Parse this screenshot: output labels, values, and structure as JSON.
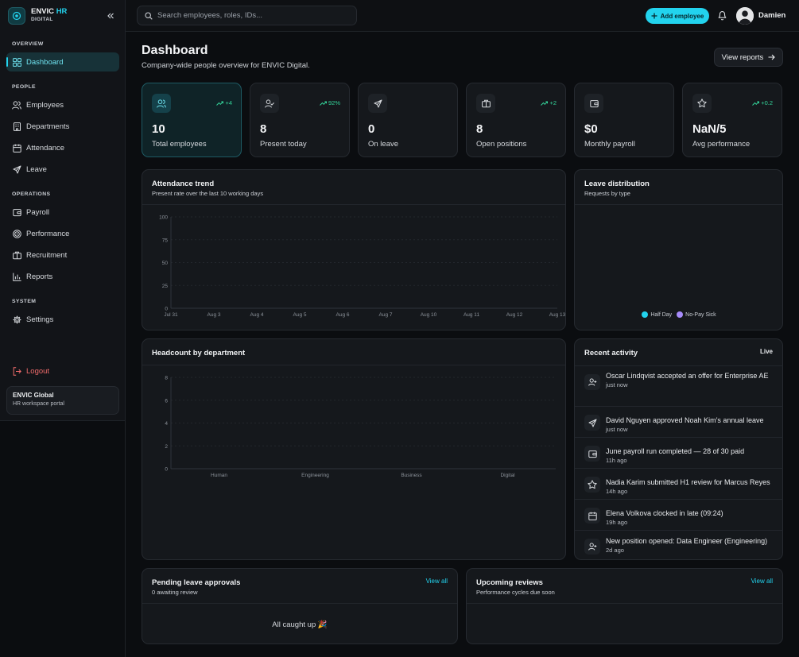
{
  "brand": {
    "name": "ENVIC",
    "name_accent": "HR",
    "sub": "DIGITAL"
  },
  "sidebar": {
    "sections": [
      {
        "label": "OVERVIEW"
      },
      {
        "label": "PEOPLE"
      },
      {
        "label": "OPERATIONS"
      },
      {
        "label": "SYSTEM"
      }
    ],
    "items": [
      {
        "label": "Dashboard",
        "icon": "grid-icon"
      },
      {
        "label": "Employees",
        "icon": "users-icon"
      },
      {
        "label": "Departments",
        "icon": "building-icon"
      },
      {
        "label": "Attendance",
        "icon": "calendar-icon"
      },
      {
        "label": "Leave",
        "icon": "plane-icon"
      },
      {
        "label": "Payroll",
        "icon": "wallet-icon"
      },
      {
        "label": "Performance",
        "icon": "target-icon"
      },
      {
        "label": "Recruitment",
        "icon": "briefcase-icon"
      },
      {
        "label": "Reports",
        "icon": "bar-chart-icon"
      },
      {
        "label": "Settings",
        "icon": "gear-icon"
      }
    ],
    "logout_label": "Logout",
    "org": {
      "name": "ENVIC Global",
      "sub": "HR workspace portal"
    }
  },
  "topbar": {
    "search_placeholder": "Search employees, roles, IDs...",
    "add_label": "Add employee",
    "user_name": "Damien"
  },
  "header": {
    "title": "Dashboard",
    "subtitle": "Company-wide people overview for ENVIC Digital.",
    "view_reports": "View reports"
  },
  "stats": [
    {
      "value": "10",
      "label": "Total employees",
      "delta": "+4",
      "icon": "users-icon"
    },
    {
      "value": "8",
      "label": "Present today",
      "delta": "92%",
      "icon": "user-check-icon"
    },
    {
      "value": "0",
      "label": "On leave",
      "delta": "",
      "icon": "plane-icon"
    },
    {
      "value": "8",
      "label": "Open positions",
      "delta": "+2",
      "icon": "briefcase-icon"
    },
    {
      "value": "$0",
      "label": "Monthly payroll",
      "delta": "",
      "icon": "wallet-icon"
    },
    {
      "value": "NaN/5",
      "label": "Avg performance",
      "delta": "+0.2",
      "icon": "star-icon"
    }
  ],
  "attendance": {
    "title": "Attendance trend",
    "subtitle": "Present rate over the last 10 working days"
  },
  "leave_dist": {
    "title": "Leave distribution",
    "subtitle": "Requests by type",
    "legend": [
      {
        "name": "Half Day",
        "color": "#22d3ee"
      },
      {
        "name": "No-Pay Sick",
        "color": "#a78bfa"
      }
    ]
  },
  "headcount": {
    "title": "Headcount by department"
  },
  "activity": {
    "title": "Recent activity",
    "live": "Live",
    "items": [
      {
        "text": "Oscar Lindqvist accepted an offer for Enterprise AE",
        "time": "just now",
        "icon": "user-plus-icon"
      },
      {
        "text": "David Nguyen approved Noah Kim’s annual leave",
        "time": "just now",
        "icon": "plane-icon"
      },
      {
        "text": "June payroll run completed — 28 of 30 paid",
        "time": "11h ago",
        "icon": "wallet-icon"
      },
      {
        "text": "Nadia Karim submitted H1 review for Marcus Reyes",
        "time": "14h ago",
        "icon": "star-icon"
      },
      {
        "text": "Elena Volkova clocked in late (09:24)",
        "time": "19h ago",
        "icon": "calendar-icon"
      },
      {
        "text": "New position opened: Data Engineer (Engineering)",
        "time": "2d ago",
        "icon": "user-plus-icon"
      }
    ]
  },
  "pending": {
    "title": "Pending leave approvals",
    "subtitle": "0 awaiting review",
    "link": "View all",
    "empty": "All caught up 🎉"
  },
  "reviews": {
    "title": "Upcoming reviews",
    "subtitle": "Performance cycles due soon",
    "link": "View all"
  },
  "chart_data": [
    {
      "type": "line",
      "categories": [
        "Jul 31",
        "Aug 3",
        "Aug 4",
        "Aug 5",
        "Aug 6",
        "Aug 7",
        "Aug 10",
        "Aug 11",
        "Aug 12",
        "Aug 13"
      ],
      "series": [],
      "ylim": [
        0,
        100
      ],
      "yticks": [
        0,
        25,
        50,
        75,
        100
      ],
      "grid": true
    },
    {
      "type": "bar",
      "categories": [
        "Human",
        "Engineering",
        "Business",
        "Digital"
      ],
      "series": [],
      "ylim": [
        0,
        8
      ],
      "yticks": [
        0,
        2,
        4,
        6,
        8
      ],
      "grid": true
    },
    {
      "type": "pie",
      "categories": [
        "Half Day",
        "No-Pay Sick"
      ],
      "values": [],
      "legend": "bottom"
    }
  ]
}
